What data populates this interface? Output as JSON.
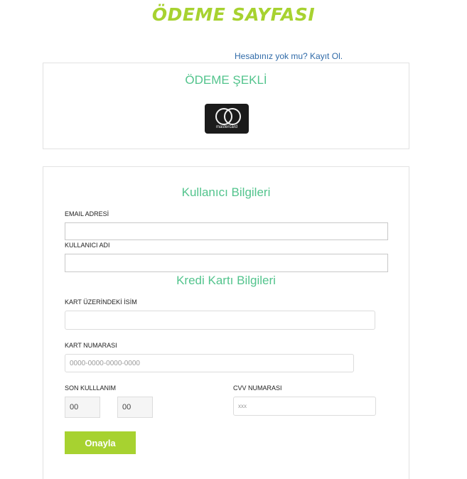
{
  "page": {
    "title": "ÖDEME SAYFASI",
    "signup_link": "Hesabınız yok mu? Kayıt Ol."
  },
  "payment_method": {
    "heading": "ÖDEME ŞEKLİ",
    "card_brand": "mastercard"
  },
  "user_info": {
    "heading": "Kullanıcı Bilgileri",
    "email_label": "EMAIL ADRESİ",
    "email_value": "",
    "username_label": "KULLANICI ADI",
    "username_value": ""
  },
  "card_info": {
    "heading": "Kredi Kartı Bilgileri",
    "name_label": "KART ÜZERİNDEKİ İSİM",
    "name_value": "",
    "number_label": "KART NUMARASI",
    "number_placeholder": "0000-0000-0000-0000",
    "expiry_label": "SON KULLLANIM",
    "expiry_month": "00",
    "expiry_year": "00",
    "cvv_label": "CVV NUMARASI",
    "cvv_placeholder": "xxx"
  },
  "actions": {
    "confirm_label": "Onayla"
  },
  "colors": {
    "accent_green": "#a7d230",
    "heading_green": "#53c48d",
    "link_blue": "#2f6aa8"
  }
}
